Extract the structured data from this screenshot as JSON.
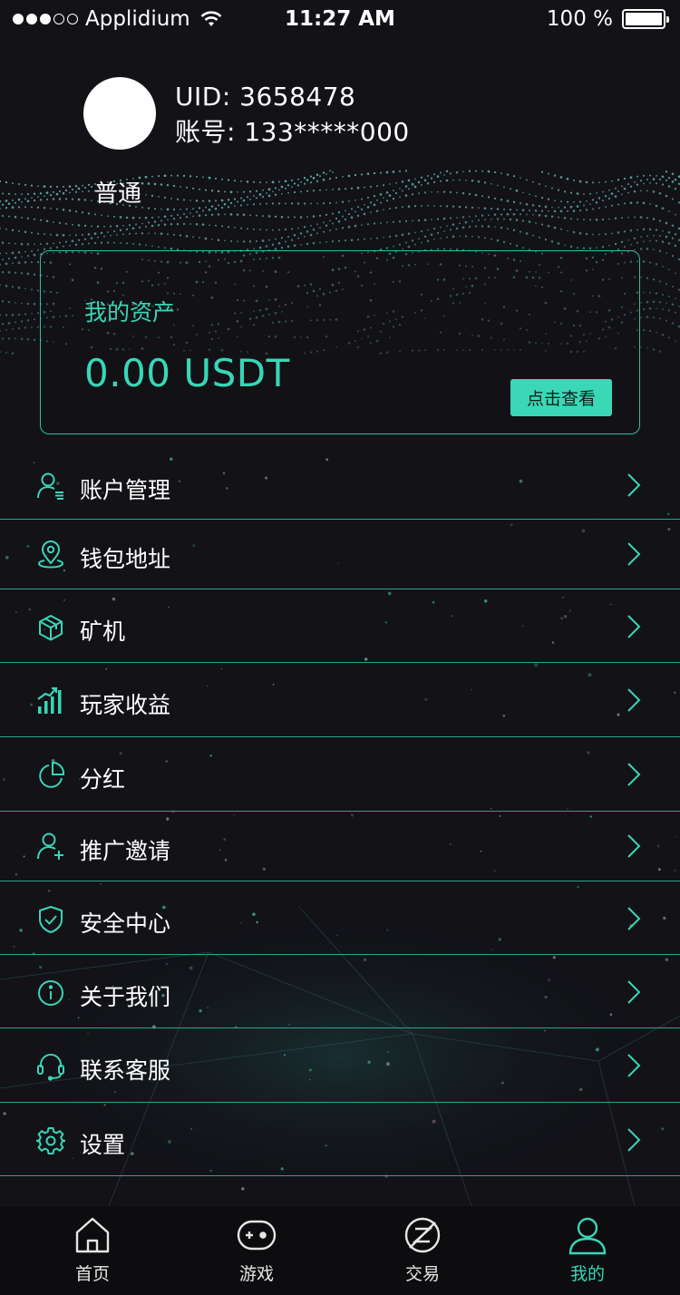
{
  "status_bar": {
    "carrier": "Applidium",
    "time": "11:27 AM",
    "battery": "100 %"
  },
  "profile": {
    "uid_label": "UID:",
    "uid_value": "3658478",
    "account_label": "账号:",
    "account_value": "133*****000",
    "level": "普通"
  },
  "asset": {
    "title": "我的资产",
    "value": "0.00 USDT",
    "button": "点击查看"
  },
  "menu": {
    "items": [
      {
        "label": "账户管理",
        "icon": "user-manage-icon"
      },
      {
        "label": "钱包地址",
        "icon": "location-pin-icon"
      },
      {
        "label": "矿机",
        "icon": "cube-icon"
      },
      {
        "label": "玩家收益",
        "icon": "bar-chart-icon"
      },
      {
        "label": "分红",
        "icon": "pie-chart-icon"
      },
      {
        "label": "推广邀请",
        "icon": "user-add-icon"
      },
      {
        "label": "安全中心",
        "icon": "shield-check-icon"
      },
      {
        "label": "关于我们",
        "icon": "info-icon"
      },
      {
        "label": "联系客服",
        "icon": "headset-icon"
      },
      {
        "label": "设置",
        "icon": "gear-icon"
      }
    ]
  },
  "tab_bar": {
    "tabs": [
      {
        "label": "首页",
        "icon": "home-icon"
      },
      {
        "label": "游戏",
        "icon": "gamepad-icon"
      },
      {
        "label": "交易",
        "icon": "trade-icon"
      },
      {
        "label": "我的",
        "icon": "person-icon",
        "active": true
      }
    ]
  },
  "colors": {
    "accent": "#39d6b7",
    "background": "#121217",
    "divider": "#2aa58d",
    "tab_bar": "#0d0d10"
  }
}
